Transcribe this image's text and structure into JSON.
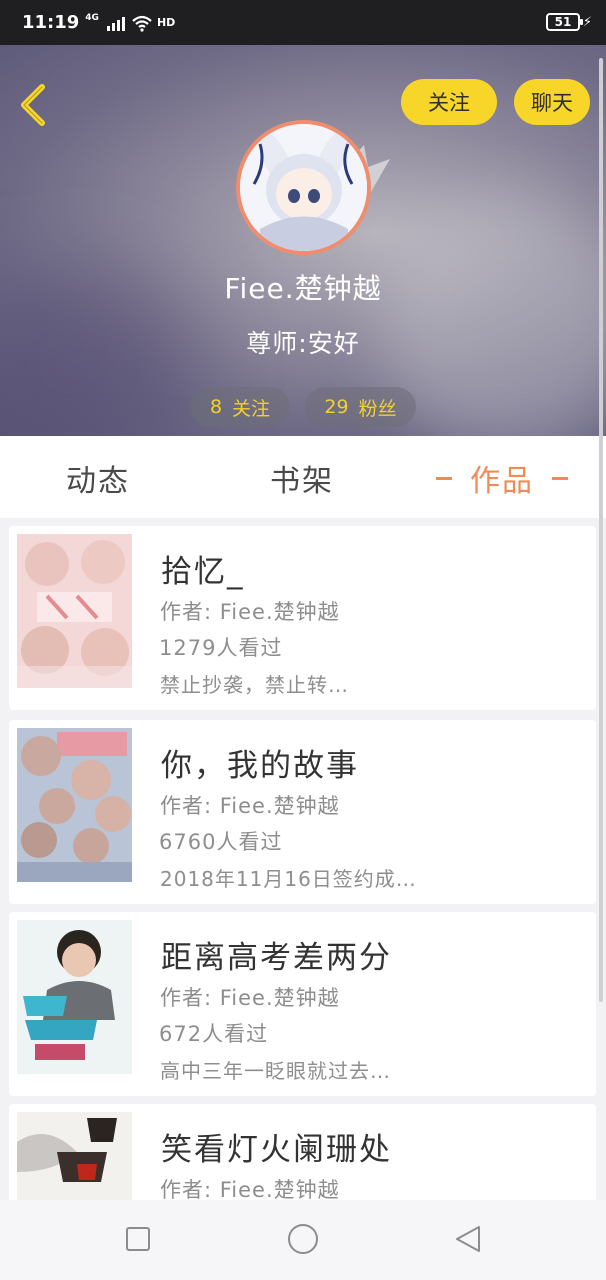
{
  "status_bar": {
    "time": "11:19",
    "network": "4G",
    "hd": "HD",
    "battery": "51"
  },
  "profile": {
    "follow_button": "关注",
    "chat_button": "聊天",
    "username": "Fiee.楚钟越",
    "mentor": "尊师:安好",
    "following": {
      "count": "8",
      "label": "关注"
    },
    "fans": {
      "count": "29",
      "label": "粉丝"
    }
  },
  "tabs": {
    "dynamic": "动态",
    "bookshelf": "书架",
    "works": "作品",
    "active": "works"
  },
  "works": [
    {
      "title": "拾忆_",
      "author": "作者: Fiee.楚钟越",
      "views": "1279人看过",
      "desc": "禁止抄袭，禁止转…"
    },
    {
      "title": "你，我的故事",
      "author": "作者: Fiee.楚钟越",
      "views": "6760人看过",
      "desc": "2018年11月16日签约成…"
    },
    {
      "title": "距离高考差两分",
      "author": "作者: Fiee.楚钟越",
      "views": "672人看过",
      "desc": "高中三年一眨眼就过去…"
    },
    {
      "title": "笑看灯火阑珊处",
      "author": "作者: Fiee.楚钟越",
      "views": "",
      "desc": ""
    }
  ],
  "colors": {
    "accent_yellow": "#f7d629",
    "tab_active": "#f08b58",
    "avatar_border": "#ef8d6e"
  },
  "icons": {
    "back": "chevron-left-icon",
    "nav_recent": "square-icon",
    "nav_home": "circle-icon",
    "nav_back": "triangle-back-icon"
  }
}
